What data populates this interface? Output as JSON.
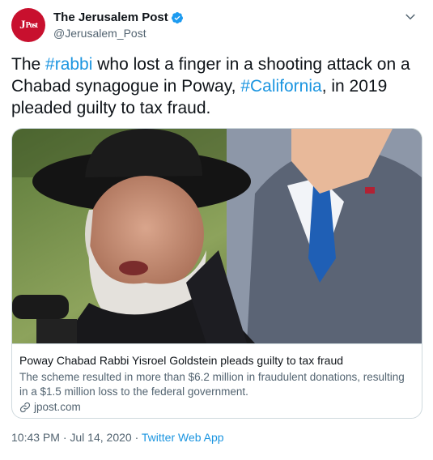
{
  "account": {
    "name": "The Jerusalem Post",
    "handle": "@Jerusalem_Post",
    "avatar_main": "J",
    "avatar_sub": "Post"
  },
  "tweet": {
    "part1": "The ",
    "hashtag1": "#rabbi",
    "part2": " who lost a finger in a shooting attack on a Chabad synagogue in Poway, ",
    "hashtag2": "#California",
    "part3": ", in 2019 pleaded guilty to tax fraud."
  },
  "card": {
    "title": "Poway Chabad Rabbi Yisroel Goldstein pleads guilty to tax fraud",
    "description": "The scheme resulted in more than $6.2 million in fraudulent donations, resulting in a $1.5 million loss to the federal government.",
    "domain": "jpost.com"
  },
  "meta": {
    "time": "10:43 PM",
    "sep1": " · ",
    "date": "Jul 14, 2020",
    "sep2": " · ",
    "app": "Twitter Web App"
  },
  "colors": {
    "link": "#1b95e0",
    "avatar": "#c8102e",
    "secondary": "#536471"
  },
  "icons": [
    "verified-badge-icon",
    "chevron-down-icon",
    "link-icon"
  ]
}
